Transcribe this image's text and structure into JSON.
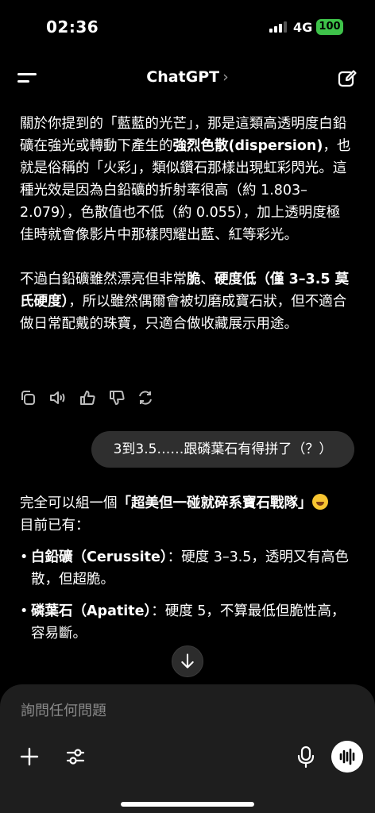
{
  "status_bar": {
    "time": "02:36",
    "network": "4G",
    "battery": "100"
  },
  "nav": {
    "title": "ChatGPT",
    "chevron": "›"
  },
  "assistant_message": {
    "p1_a": "關於你提到的「藍藍的光芒」，那是這類高透明度白鉛礦在強光或轉動下產生的",
    "p1_b": "強烈色散(dispersion)",
    "p1_c": "，也就是俗稱的「火彩」，類似鑽石那樣出現虹彩閃光。這種光效是因為白鉛礦的折射率很高（約 1.803–2.079），色散值也不低（約 0.055），加上透明度極佳時就會像影片中那樣閃耀出藍、紅等彩光。",
    "p2_a": "不過白鉛礦雖然漂亮但非常",
    "p2_b": "脆",
    "p2_c": "、",
    "p2_d": "硬度低（僅 3–3.5 莫氏硬度）",
    "p2_e": "，所以雖然偶爾會被切磨成寶石狀，但不適合做日常配戴的珠寶，只適合做收藏展示用途。"
  },
  "message_actions": [
    "copy-icon",
    "speaker-icon",
    "thumbs-up-icon",
    "thumbs-down-icon",
    "regenerate-icon"
  ],
  "user_message": "3到3.5……跟磷葉石有得拼了（？）",
  "reply": {
    "intro_a": "完全可以組一個",
    "intro_b": "「超美但一碰就碎系寶石戰隊」",
    "line2": "目前已有：",
    "items": [
      {
        "name": "白鉛礦（Cerussite）",
        "desc": "：硬度 3–3.5，透明又有高色散，但超脆。"
      },
      {
        "name": "磷葉石（Apatite）",
        "desc": "：硬度 5，不算最低但脆性高，容易斷。"
      }
    ]
  },
  "composer": {
    "placeholder": "詢問任何問題"
  },
  "colors": {
    "background": "#000000",
    "bubble": "#2f2f2f",
    "composer": "#1e1e1e",
    "battery": "#3ec24a"
  }
}
